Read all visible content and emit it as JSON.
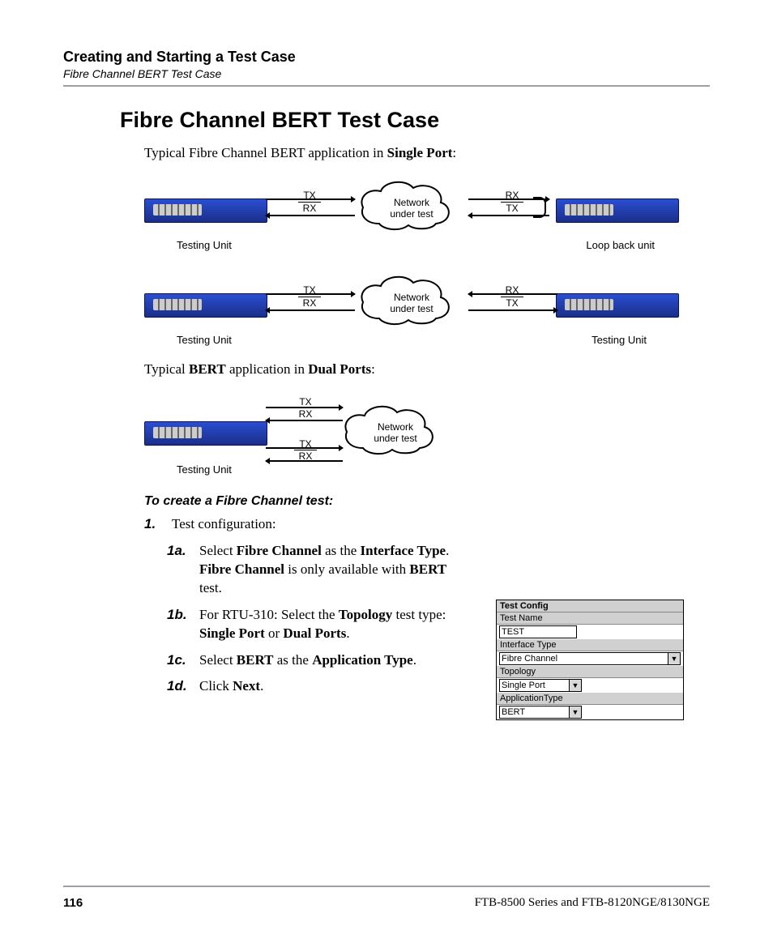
{
  "header": {
    "chapter": "Creating and Starting a Test Case",
    "section": "Fibre Channel BERT Test Case"
  },
  "title": "Fibre Channel BERT Test Case",
  "paragraphs": {
    "p1_pre": "Typical Fibre Channel BERT application in ",
    "p1_b": "Single Port",
    "p1_post": ":",
    "p2_pre": "Typical ",
    "p2_b1": "BERT",
    "p2_mid": " application in ",
    "p2_b2": "Dual Ports",
    "p2_post": ":"
  },
  "diagram": {
    "tx": "TX",
    "rx": "RX",
    "cloud_line1": "Network",
    "cloud_line2": "under test",
    "testing_unit": "Testing Unit",
    "loopback": "Loop back unit"
  },
  "subheading": "To create a Fibre Channel test:",
  "steps": {
    "n1": "1.",
    "n1txt": "Test configuration:",
    "n1a": "1a.",
    "n1a_txt": {
      "t1": "Select ",
      "b1": "Fibre Channel",
      "t2": " as the ",
      "b2": "Interface Type",
      "t3": ". ",
      "b3": "Fibre Channel",
      "t4": " is only available with ",
      "b4": "BERT",
      "t5": " test."
    },
    "n1b": "1b.",
    "n1b_txt": {
      "t1": "For RTU-310: Select the ",
      "b1": "Topology",
      "t2": " test type: ",
      "b2": "Single Port",
      "t3": " or ",
      "b3": "Dual Ports",
      "t4": "."
    },
    "n1c": "1c.",
    "n1c_txt": {
      "t1": "Select ",
      "b1": "BERT",
      "t2": " as the ",
      "b2": "Application Type",
      "t3": "."
    },
    "n1d": "1d.",
    "n1d_txt": {
      "t1": "Click ",
      "b1": "Next",
      "t2": "."
    }
  },
  "config": {
    "title": "Test Config",
    "test_name_label": "Test Name",
    "test_name_value": "TEST",
    "interface_label": "Interface Type",
    "interface_value": "Fibre Channel",
    "topology_label": "Topology",
    "topology_value": "Single Port",
    "apptype_label": "ApplicationType",
    "apptype_value": "BERT",
    "dropdown_glyph": "▼"
  },
  "footer": {
    "page": "116",
    "doc": "FTB-8500 Series and FTB-8120NGE/8130NGE"
  }
}
